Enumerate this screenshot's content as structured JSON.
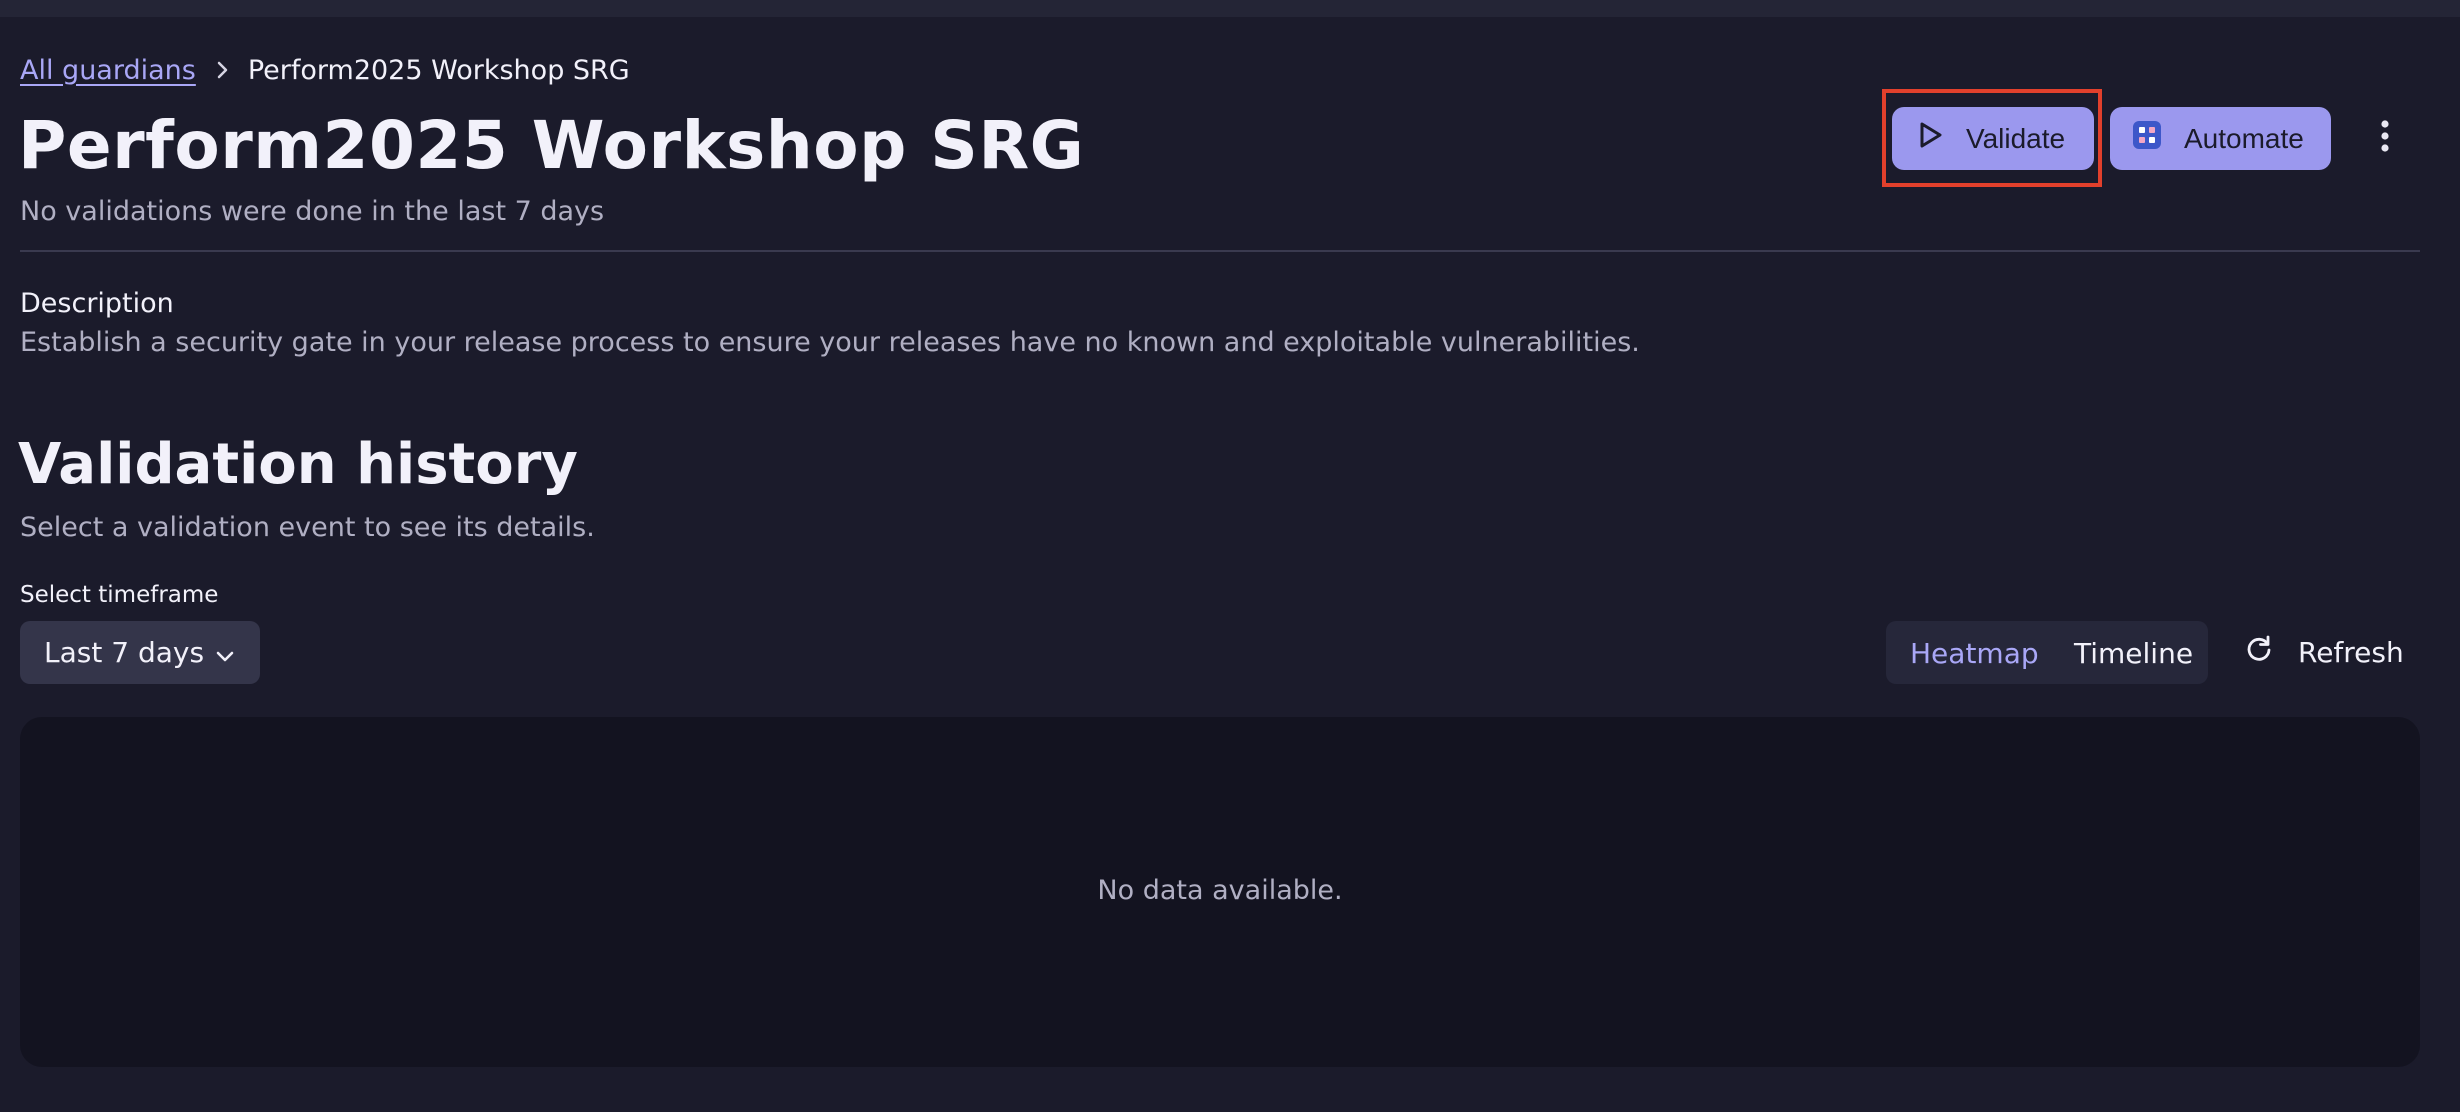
{
  "breadcrumb": {
    "parent": "All guardians",
    "current": "Perform2025 Workshop SRG"
  },
  "header": {
    "title": "Perform2025 Workshop SRG",
    "subtitle": "No validations were done in the last 7 days",
    "validate_label": "Validate",
    "automate_label": "Automate"
  },
  "description": {
    "label": "Description",
    "text": "Establish a security gate in your release process to ensure your releases have no known and exploitable vulnerabilities."
  },
  "history": {
    "title": "Validation history",
    "subtitle": "Select a validation event to see its details.",
    "timeframe_label": "Select timeframe",
    "timeframe_value": "Last 7 days",
    "views": [
      "Heatmap",
      "Timeline"
    ],
    "active_view": "Heatmap",
    "refresh_label": "Refresh",
    "empty_text": "No data available."
  },
  "colors": {
    "background": "#1b1b2b",
    "accent": "#9b98ee",
    "link": "#a9a7f6",
    "highlight": "#e2402c"
  },
  "icons": [
    "chevron-right-icon",
    "play-icon",
    "automate-icon",
    "more-vertical-icon",
    "chevron-down-icon",
    "refresh-icon"
  ]
}
